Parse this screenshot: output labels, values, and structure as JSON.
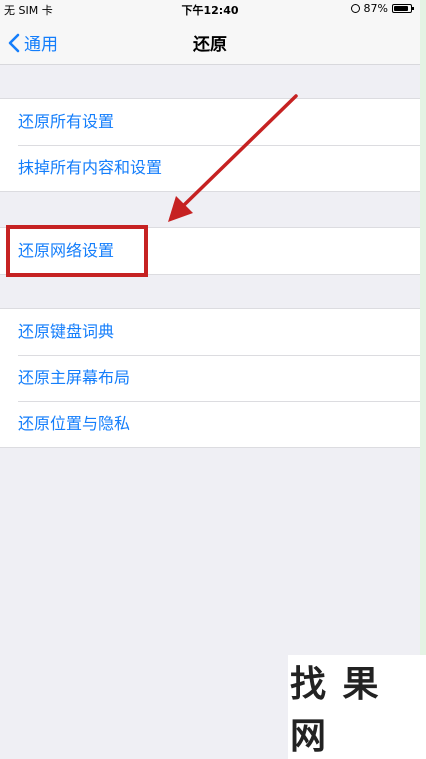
{
  "status_bar": {
    "carrier": "无 SIM 卡",
    "time": "下午12:40",
    "battery": "87%"
  },
  "nav": {
    "back_label": "通用",
    "title": "还原"
  },
  "groups": [
    {
      "items": [
        "还原所有设置",
        "抹掉所有内容和设置"
      ]
    },
    {
      "items": [
        "还原网络设置"
      ]
    },
    {
      "items": [
        "还原键盘词典",
        "还原主屏幕布局",
        "还原位置与隐私"
      ]
    }
  ],
  "watermark": {
    "text": "找 果 网"
  },
  "colors": {
    "accent": "#147efb",
    "highlight": "#c62222",
    "background": "#efeff4"
  }
}
